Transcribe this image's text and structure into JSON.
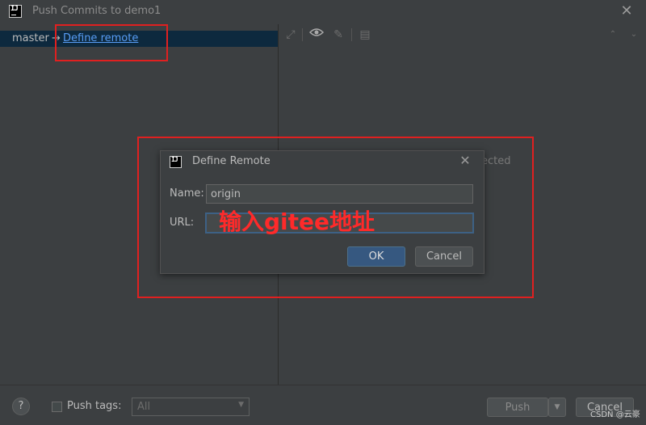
{
  "window": {
    "title": "Push Commits to demo1",
    "app_icon_text": "IJ"
  },
  "left": {
    "local_branch": "master",
    "arrow": "→",
    "define_remote_link": "Define remote"
  },
  "right": {
    "status_fragment": "ected"
  },
  "dialog": {
    "title": "Define Remote",
    "icon_text": "IJ",
    "name_label": "Name:",
    "name_value": "origin",
    "url_label": "URL:",
    "url_value": "",
    "url_annotation": "输入gitee地址",
    "ok_label": "OK",
    "cancel_label": "Cancel"
  },
  "bottom": {
    "help_label": "?",
    "push_tags_label": "Push tags:",
    "tags_value": "All",
    "push_label": "Push",
    "cancel_label": "Cancel",
    "watermark": "CSDN @云豪"
  },
  "colors": {
    "background": "#3c3f41",
    "selection": "#0d293e",
    "link": "#589df6",
    "annotation": "#e02020",
    "primary_button": "#365880"
  }
}
